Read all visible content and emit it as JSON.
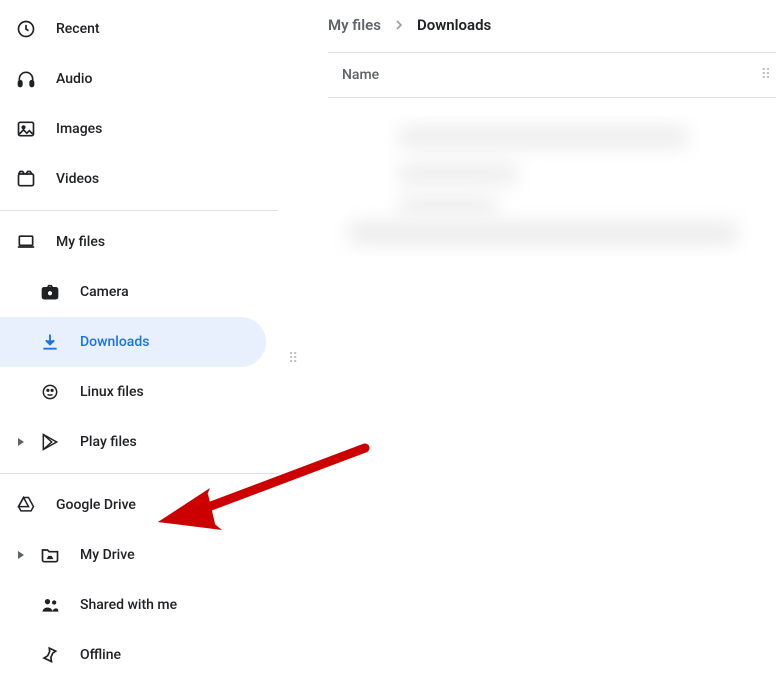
{
  "sidebar": {
    "quick": [
      {
        "label": "Recent"
      },
      {
        "label": "Audio"
      },
      {
        "label": "Images"
      },
      {
        "label": "Videos"
      }
    ],
    "myfiles_label": "My files",
    "myfiles_children": [
      {
        "label": "Camera"
      },
      {
        "label": "Downloads",
        "active": true
      },
      {
        "label": "Linux files"
      },
      {
        "label": "Play files",
        "has_caret": true
      }
    ],
    "drive_label": "Google Drive",
    "drive_children": [
      {
        "label": "My Drive",
        "has_caret": true
      },
      {
        "label": "Shared with me"
      },
      {
        "label": "Offline"
      }
    ]
  },
  "breadcrumbs": {
    "parent": "My files",
    "current": "Downloads"
  },
  "table": {
    "column_name": "Name"
  },
  "annotation": {
    "arrow_target": "google-drive",
    "arrow_color": "#cc0000"
  }
}
